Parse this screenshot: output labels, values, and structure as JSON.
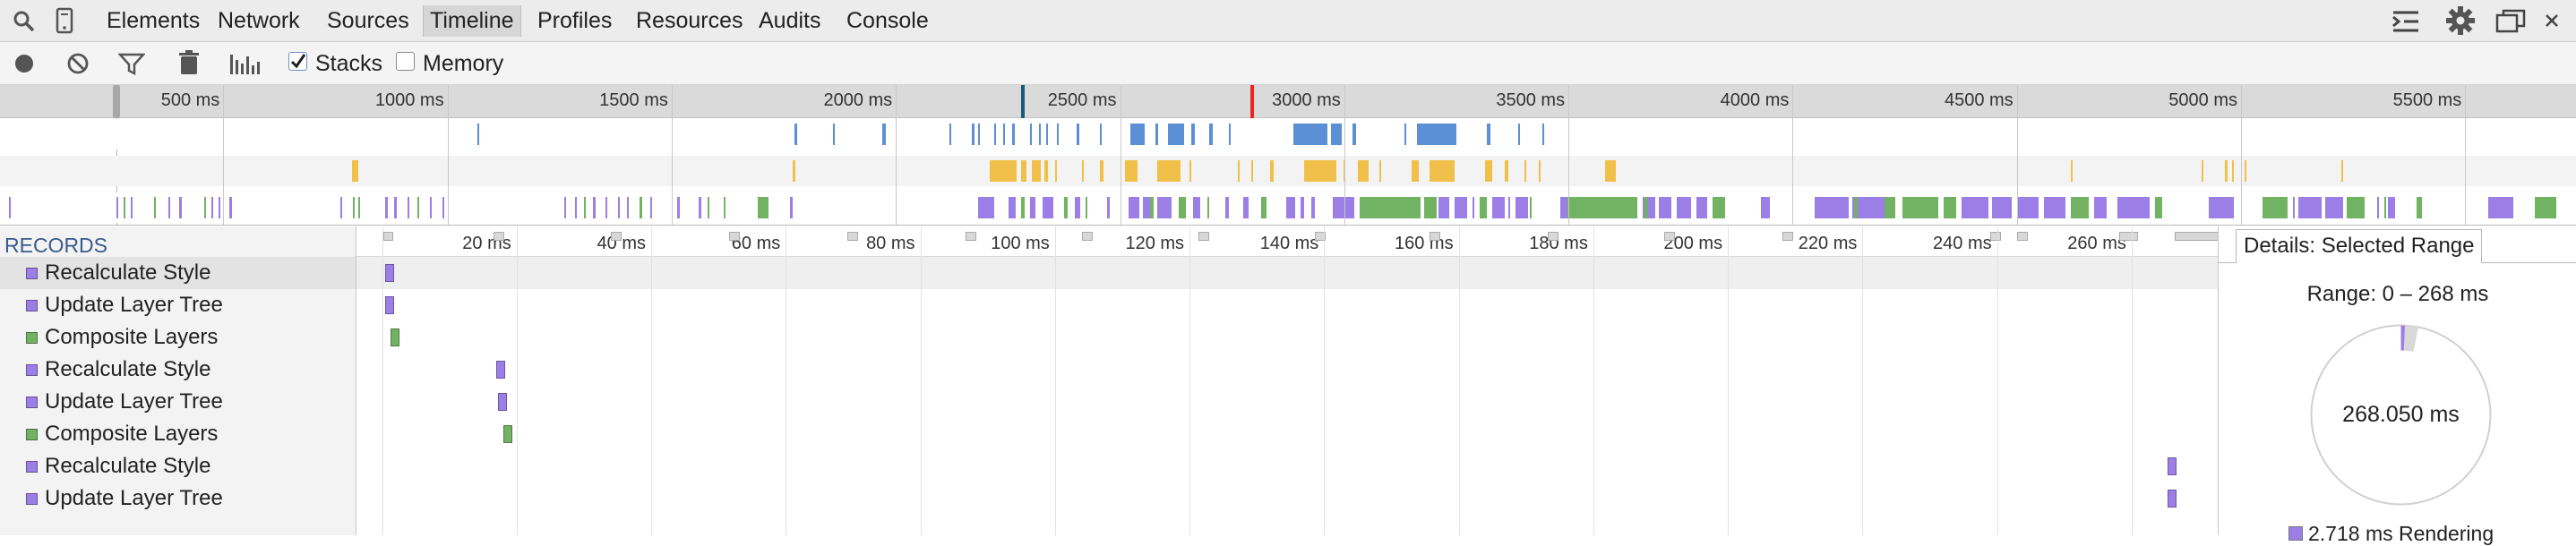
{
  "tabs": [
    "Elements",
    "Network",
    "Sources",
    "Timeline",
    "Profiles",
    "Resources",
    "Audits",
    "Console"
  ],
  "active_tab": "Timeline",
  "toolbar": {
    "stacks_label": "Stacks",
    "stacks_checked": true,
    "memory_label": "Memory",
    "memory_checked": false
  },
  "overview": {
    "ticks": [
      "500 ms",
      "1000 ms",
      "1500 ms",
      "2000 ms",
      "2500 ms",
      "3000 ms",
      "3500 ms",
      "4000 ms",
      "4500 ms",
      "5000 ms",
      "5500 ms"
    ]
  },
  "records": {
    "header": "RECORDS",
    "items": [
      {
        "label": "Recalculate Style",
        "color": "#9b7fe6",
        "ms": 0.4
      },
      {
        "label": "Update Layer Tree",
        "color": "#9b7fe6",
        "ms": 0.4
      },
      {
        "label": "Composite Layers",
        "color": "#71b363",
        "ms": 1.3
      },
      {
        "label": "Recalculate Style",
        "color": "#9b7fe6",
        "ms": 17.0
      },
      {
        "label": "Update Layer Tree",
        "color": "#9b7fe6",
        "ms": 17.3
      },
      {
        "label": "Composite Layers",
        "color": "#71b363",
        "ms": 18.0
      },
      {
        "label": "Recalculate Style",
        "color": "#9b7fe6",
        "ms": 265.4
      },
      {
        "label": "Update Layer Tree",
        "color": "#9b7fe6",
        "ms": 265.4
      }
    ]
  },
  "flame": {
    "ticks": [
      "20 ms",
      "40 ms",
      "60 ms",
      "80 ms",
      "100 ms",
      "120 ms",
      "140 ms",
      "160 ms",
      "180 ms",
      "200 ms",
      "220 ms",
      "240 ms",
      "260 ms"
    ]
  },
  "details": {
    "tab_label": "Details: Selected Range",
    "range_label": "Range: 0 – 268 ms",
    "total_label": "268.050 ms",
    "legend_label": "2.718 ms Rendering",
    "rendering_color": "#9b7fe6"
  },
  "colors": {
    "loading": "#5b8fd6",
    "scripting": "#f0c04a",
    "rendering": "#9b7fe6",
    "painting": "#71b363"
  }
}
